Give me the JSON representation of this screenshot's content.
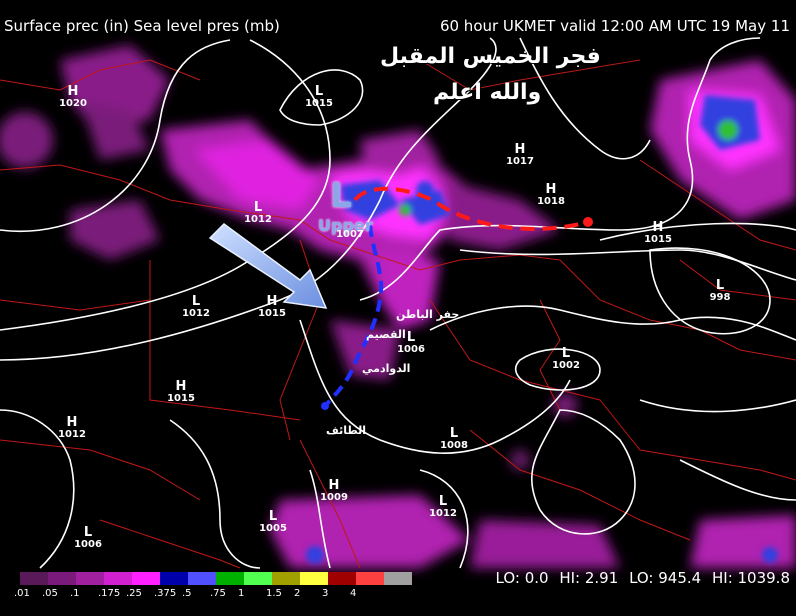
{
  "header": {
    "left": "Surface prec (in)  Sea level pres (mb)",
    "right": "60 hour UKMET valid 12:00 AM UTC 19 May 11"
  },
  "title_ar": {
    "line1": "فجر الخميس المقبل",
    "line2": "والله اعلم"
  },
  "pressure_centers": [
    {
      "type": "H",
      "value": "1020"
    },
    {
      "type": "L",
      "value": "1015"
    },
    {
      "type": "H",
      "value": "1017"
    },
    {
      "type": "H",
      "value": "1018"
    },
    {
      "type": "H",
      "value": "1015"
    },
    {
      "type": "L",
      "value": "1012"
    },
    {
      "type": "H",
      "value": "1015"
    },
    {
      "type": "L",
      "value": "1012"
    },
    {
      "type": "L",
      "value": "998"
    },
    {
      "type": "L",
      "value": "1006"
    },
    {
      "type": "L",
      "value": "1002"
    },
    {
      "type": "H",
      "value": "1015"
    },
    {
      "type": "H",
      "value": "1012"
    },
    {
      "type": "L",
      "value": "1008"
    },
    {
      "type": "H",
      "value": "1009"
    },
    {
      "type": "L",
      "value": "1012"
    },
    {
      "type": "L",
      "value": "1005"
    },
    {
      "type": "L",
      "value": "1006"
    },
    {
      "type": "L",
      "value": "1007"
    }
  ],
  "cities_ar": [
    "حفر الباطن",
    "القصيم",
    "الدوادمي",
    "الطائف"
  ],
  "upper_label": "Upper",
  "upper_low_symbol": "L",
  "legend": {
    "colors": [
      "#5a1a5a",
      "#7a1a7a",
      "#a020a0",
      "#d020d0",
      "#ff20ff",
      "#0000aa",
      "#5050ff",
      "#00b000",
      "#50ff50",
      "#a0a000",
      "#ffff40",
      "#a00000",
      "#ff4040",
      "#a0a0a0"
    ],
    "labels": [
      ".01",
      ".05",
      ".1",
      ".175",
      ".25",
      ".375",
      ".5",
      ".75",
      "1",
      "1.5",
      "2",
      "3",
      "4"
    ]
  },
  "stats": {
    "lo_prec": "LO:    0.0",
    "hi_prec": "HI:   2.91",
    "lo_pres": "LO: 945.4",
    "hi_pres": "HI: 1039.8"
  }
}
